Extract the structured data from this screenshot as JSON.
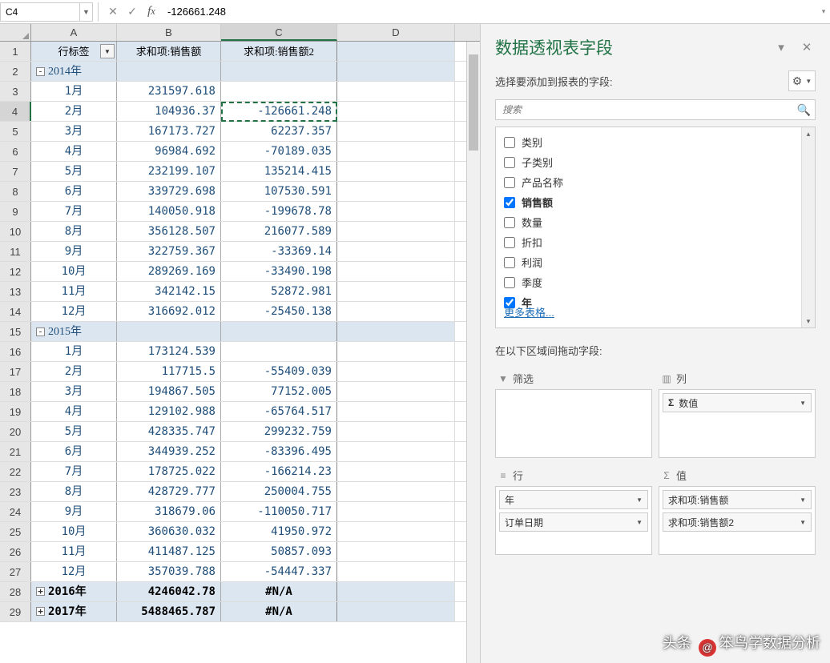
{
  "name_box": "C4",
  "formula_value": "-126661.248",
  "columns": [
    "A",
    "B",
    "C",
    "D"
  ],
  "col_widths": {
    "A": 107,
    "B": 130,
    "C": 145,
    "D": 147
  },
  "header": {
    "rowlabel": "行标签",
    "sum1": "求和项:销售额",
    "sum2": "求和项:销售额2"
  },
  "sheet": [
    {
      "n": 2,
      "type": "group",
      "exp": "-",
      "a": "2014年"
    },
    {
      "n": 3,
      "a": "1月",
      "b": "231597.618",
      "c": ""
    },
    {
      "n": 4,
      "a": "2月",
      "b": "104936.37",
      "c": "-126661.248",
      "active": true
    },
    {
      "n": 5,
      "a": "3月",
      "b": "167173.727",
      "c": "62237.357"
    },
    {
      "n": 6,
      "a": "4月",
      "b": "96984.692",
      "c": "-70189.035"
    },
    {
      "n": 7,
      "a": "5月",
      "b": "232199.107",
      "c": "135214.415"
    },
    {
      "n": 8,
      "a": "6月",
      "b": "339729.698",
      "c": "107530.591"
    },
    {
      "n": 9,
      "a": "7月",
      "b": "140050.918",
      "c": "-199678.78"
    },
    {
      "n": 10,
      "a": "8月",
      "b": "356128.507",
      "c": "216077.589"
    },
    {
      "n": 11,
      "a": "9月",
      "b": "322759.367",
      "c": "-33369.14"
    },
    {
      "n": 12,
      "a": "10月",
      "b": "289269.169",
      "c": "-33490.198"
    },
    {
      "n": 13,
      "a": "11月",
      "b": "342142.15",
      "c": "52872.981"
    },
    {
      "n": 14,
      "a": "12月",
      "b": "316692.012",
      "c": "-25450.138"
    },
    {
      "n": 15,
      "type": "group",
      "exp": "-",
      "a": "2015年"
    },
    {
      "n": 16,
      "a": "1月",
      "b": "173124.539",
      "c": ""
    },
    {
      "n": 17,
      "a": "2月",
      "b": "117715.5",
      "c": "-55409.039"
    },
    {
      "n": 18,
      "a": "3月",
      "b": "194867.505",
      "c": "77152.005"
    },
    {
      "n": 19,
      "a": "4月",
      "b": "129102.988",
      "c": "-65764.517"
    },
    {
      "n": 20,
      "a": "5月",
      "b": "428335.747",
      "c": "299232.759"
    },
    {
      "n": 21,
      "a": "6月",
      "b": "344939.252",
      "c": "-83396.495"
    },
    {
      "n": 22,
      "a": "7月",
      "b": "178725.022",
      "c": "-166214.23"
    },
    {
      "n": 23,
      "a": "8月",
      "b": "428729.777",
      "c": "250004.755"
    },
    {
      "n": 24,
      "a": "9月",
      "b": "318679.06",
      "c": "-110050.717"
    },
    {
      "n": 25,
      "a": "10月",
      "b": "360630.032",
      "c": "41950.972"
    },
    {
      "n": 26,
      "a": "11月",
      "b": "411487.125",
      "c": "50857.093"
    },
    {
      "n": 27,
      "a": "12月",
      "b": "357039.788",
      "c": "-54447.337"
    },
    {
      "n": 28,
      "type": "total",
      "exp": "+",
      "a": "2016年",
      "b": "4246042.78",
      "c": "#N/A"
    },
    {
      "n": 29,
      "type": "total",
      "exp": "+",
      "a": "2017年",
      "b": "5488465.787",
      "c": "#N/A"
    }
  ],
  "pane": {
    "title": "数据透视表字段",
    "subtitle": "选择要添加到报表的字段:",
    "search_placeholder": "搜索",
    "fields": [
      {
        "label": "类别",
        "checked": false
      },
      {
        "label": "子类别",
        "checked": false
      },
      {
        "label": "产品名称",
        "checked": false
      },
      {
        "label": "销售额",
        "checked": true
      },
      {
        "label": "数量",
        "checked": false
      },
      {
        "label": "折扣",
        "checked": false
      },
      {
        "label": "利润",
        "checked": false
      },
      {
        "label": "季度",
        "checked": false
      },
      {
        "label": "年",
        "checked": true
      }
    ],
    "more_tables": "更多表格...",
    "drag_label": "在以下区域间拖动字段:",
    "areas": {
      "filter": {
        "title": "筛选",
        "items": []
      },
      "columns": {
        "title": "列",
        "items": [
          {
            "label": "数值",
            "sigma": true
          }
        ]
      },
      "rows": {
        "title": "行",
        "items": [
          {
            "label": "年"
          },
          {
            "label": "订单日期"
          }
        ]
      },
      "values": {
        "title": "值",
        "items": [
          {
            "label": "求和项:销售额"
          },
          {
            "label": "求和项:销售额2"
          }
        ]
      }
    }
  },
  "watermark": {
    "pre": "头条 ",
    "at": "@",
    "name": "笨鸟学数据分析"
  }
}
